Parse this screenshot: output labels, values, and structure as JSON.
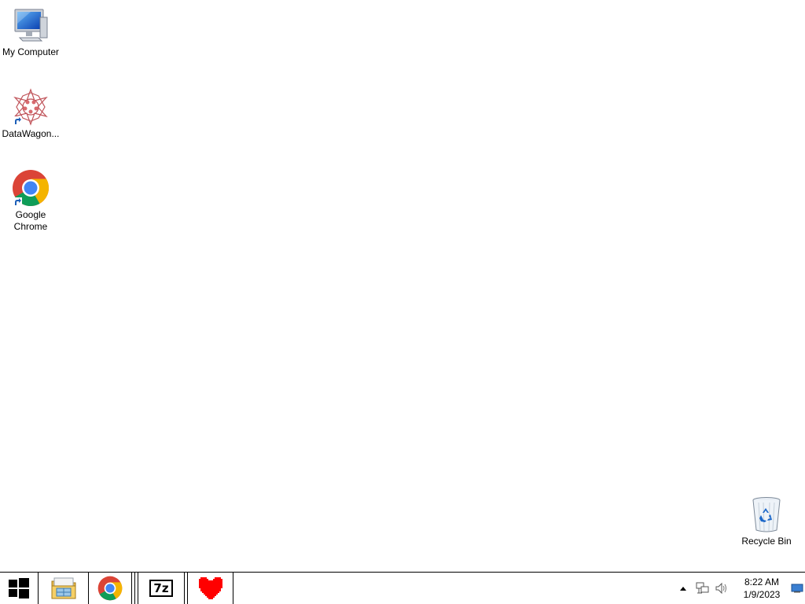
{
  "desktop": {
    "icons": [
      {
        "label": "My Computer",
        "icon": "my-computer-icon"
      },
      {
        "label": "DataWagon...",
        "icon": "datawagon-icon"
      },
      {
        "label": "Google Chrome",
        "icon": "chrome-icon"
      },
      {
        "label": "Recycle Bin",
        "icon": "recycle-bin-icon"
      }
    ]
  },
  "taskbar": {
    "pinned": [
      {
        "name": "start-button",
        "icon": "windows-logo-icon"
      },
      {
        "name": "file-explorer",
        "icon": "file-explorer-icon"
      },
      {
        "name": "google-chrome",
        "icon": "chrome-icon"
      },
      {
        "name": "7-zip",
        "icon": "7zip-icon",
        "text": "7z"
      },
      {
        "name": "heart-app",
        "icon": "heart-icon"
      }
    ],
    "tray": {
      "time": "8:22 AM",
      "date": "1/9/2023",
      "icons": [
        "show-hidden-icons-arrow",
        "network-icon",
        "volume-icon",
        "show-desktop-button"
      ]
    }
  },
  "colors": {
    "taskbar_bg": "#ffffff",
    "desktop_bg": "#ffffff",
    "heart": "#ff0000"
  }
}
